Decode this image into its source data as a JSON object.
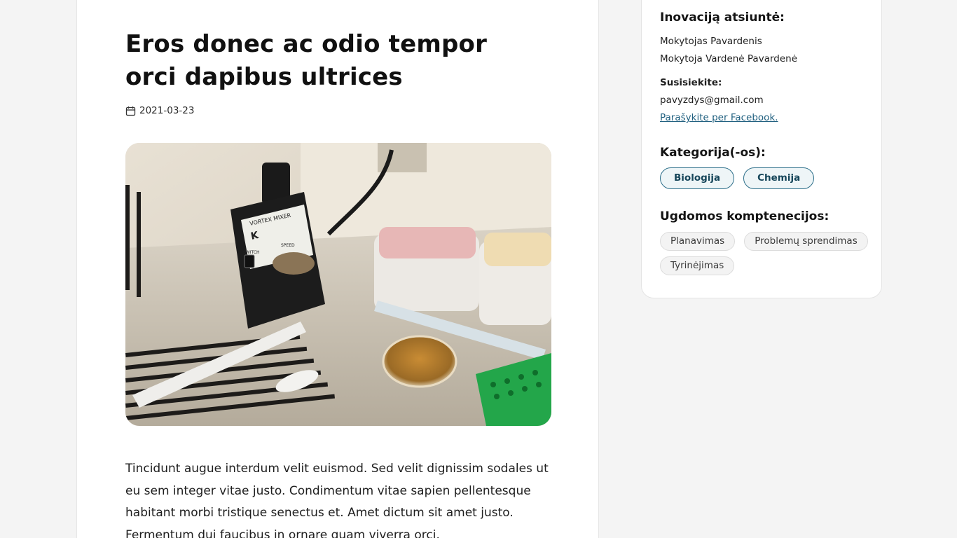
{
  "article": {
    "title": "Eros donec ac odio tempor orci dapibus ultrices",
    "date": "2021-03-23",
    "date_icon": "calendar-icon",
    "image_alt": "laboratory vortex mixer with petri dish and pipette tip box",
    "image_labels": {
      "mixer_brand": "VORTEX MIXER",
      "mixer_logo": "K",
      "switch": "SWITCH",
      "speed": "SPEED"
    },
    "body": "Tincidunt augue interdum velit euismod. Sed velit dignissim sodales ut eu sem integer vitae justo. Condimentum vitae sapien pellentesque habitant morbi tristique senectus et. Amet dictum sit amet justo. Fermentum dui faucibus in ornare quam viverra orci."
  },
  "sidebar": {
    "submitted_heading": "Inovaciją atsiuntė:",
    "submitters": [
      "Mokytojas Pavardenis",
      "Mokytoja Vardenė Pavardenė"
    ],
    "contact_label": "Susisiekite:",
    "contact_email": "pavyzdys@gmail.com",
    "facebook_link": "Parašykite per Facebook.",
    "categories_heading": "Kategorija(-os):",
    "categories": [
      "Biologija",
      "Chemija"
    ],
    "competencies_heading": "Ugdomos komptenecijos:",
    "competencies": [
      "Planavimas",
      "Problemų sprendimas",
      "Tyrinėjimas"
    ]
  },
  "colors": {
    "page_bg": "#f4f4f4",
    "card_bg": "#ffffff",
    "accent": "#2d6f8a",
    "link": "#1f5f7f"
  }
}
